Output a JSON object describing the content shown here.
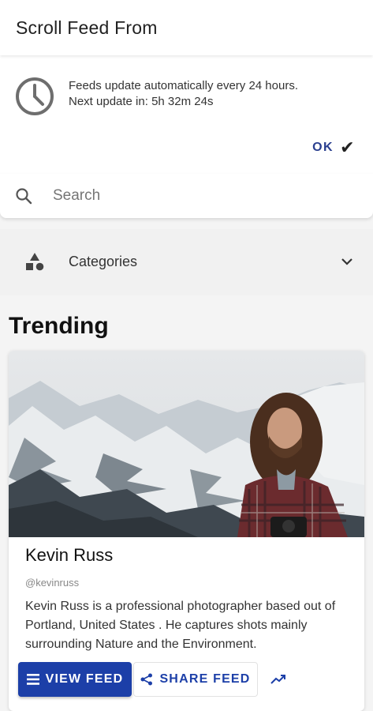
{
  "header": {
    "title": "Scroll Feed From"
  },
  "notice": {
    "line1": "Feeds update automatically every 24 hours.",
    "line2": "Next update in: 5h 32m 24s",
    "ok_label": "OK",
    "icon": "clock-icon"
  },
  "search": {
    "placeholder": "Search",
    "value": ""
  },
  "categories": {
    "label": "Categories"
  },
  "trending": {
    "heading": "Trending",
    "card": {
      "name": "Kevin Russ",
      "handle": "@kevinruss",
      "bio": "Kevin Russ is a professional photographer based out of Portland, United States . He captures shots mainly surrounding Nature and the Environment.",
      "view_label": "VIEW FEED",
      "share_label": "SHARE FEED"
    }
  },
  "colors": {
    "accent": "#1c3fa8",
    "ok_text": "#2a3f8f"
  }
}
